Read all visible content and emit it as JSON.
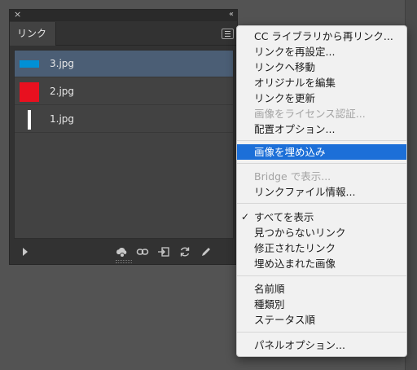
{
  "panel": {
    "tab_label": "リンク",
    "close_glyph": "×",
    "collapse_glyph": "‹‹",
    "links": [
      {
        "name": "3.jpg",
        "selected": true,
        "thumb": "blue-bar"
      },
      {
        "name": "2.jpg",
        "selected": false,
        "thumb": "red-square"
      },
      {
        "name": "1.jpg",
        "selected": false,
        "thumb": "white-bar"
      }
    ],
    "footer_icons": [
      "cc-library-icon",
      "relink-icon",
      "go-to-link-icon",
      "update-link-icon",
      "edit-original-icon"
    ]
  },
  "menu": {
    "items": [
      {
        "label": "CC ライブラリから再リンク...",
        "disabled": false
      },
      {
        "label": "リンクを再設定...",
        "disabled": false
      },
      {
        "label": "リンクへ移動",
        "disabled": false
      },
      {
        "label": "オリジナルを編集",
        "disabled": false
      },
      {
        "label": "リンクを更新",
        "disabled": false
      },
      {
        "label": "画像をライセンス認証...",
        "disabled": true
      },
      {
        "label": "配置オプション...",
        "disabled": false
      },
      {
        "label": "画像を埋め込み",
        "disabled": false,
        "highlighted": true
      },
      {
        "label": "Bridge で表示...",
        "disabled": true
      },
      {
        "label": "リンクファイル情報...",
        "disabled": false
      },
      {
        "label": "すべてを表示",
        "disabled": false,
        "checked": true
      },
      {
        "label": "見つからないリンク",
        "disabled": false
      },
      {
        "label": "修正されたリンク",
        "disabled": false
      },
      {
        "label": "埋め込まれた画像",
        "disabled": false
      },
      {
        "label": "名前順",
        "disabled": false
      },
      {
        "label": "種類別",
        "disabled": false
      },
      {
        "label": "ステータス順",
        "disabled": false
      },
      {
        "label": "パネルオプション...",
        "disabled": false
      }
    ],
    "check_glyph": "✓"
  },
  "colors": {
    "highlight": "#1c6fd8",
    "selected_row": "#4b5e75",
    "thumb_blue": "#0090d6",
    "thumb_red": "#e8101f"
  }
}
